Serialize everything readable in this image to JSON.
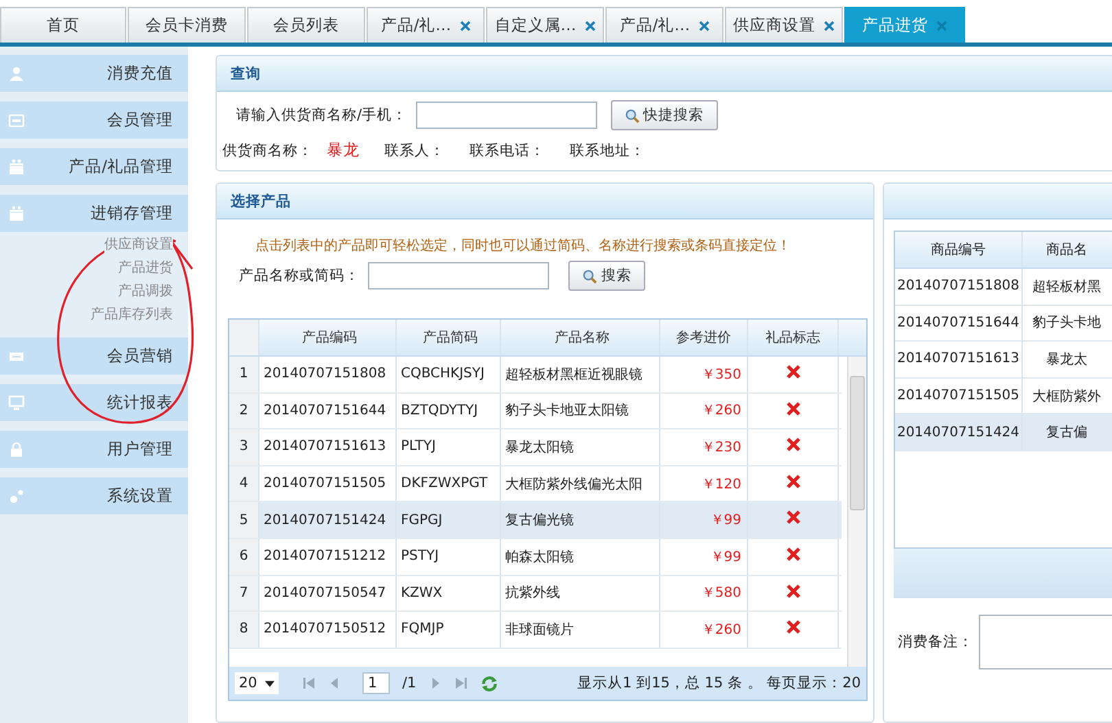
{
  "tabs": [
    {
      "label": "首页",
      "closable": false,
      "selected": false
    },
    {
      "label": "会员卡消费",
      "closable": false,
      "selected": false
    },
    {
      "label": "会员列表",
      "closable": false,
      "selected": false
    },
    {
      "label": "产品/礼…",
      "closable": true,
      "selected": false
    },
    {
      "label": "自定义属…",
      "closable": true,
      "selected": false
    },
    {
      "label": "产品/礼…",
      "closable": true,
      "selected": false
    },
    {
      "label": "供应商设置",
      "closable": true,
      "selected": false
    },
    {
      "label": "产品进货",
      "closable": true,
      "selected": true
    }
  ],
  "sidebar": {
    "items": [
      {
        "label": "消费充值"
      },
      {
        "label": "会员管理"
      },
      {
        "label": "产品/礼品管理"
      },
      {
        "label": "进销存管理",
        "children": [
          {
            "label": "供应商设置"
          },
          {
            "label": "产品进货"
          },
          {
            "label": "产品调拨"
          },
          {
            "label": "产品库存列表"
          }
        ]
      },
      {
        "label": "会员营销"
      },
      {
        "label": "统计报表"
      },
      {
        "label": "用户管理"
      },
      {
        "label": "系统设置"
      }
    ]
  },
  "query_panel": {
    "title": "查询",
    "search_label": "请输入供货商名称/手机：",
    "search_button": "快捷搜索",
    "info": [
      {
        "label": "供货商名称：",
        "value": "暴龙"
      },
      {
        "label": "联系人："
      },
      {
        "label": "联系电话："
      },
      {
        "label": "联系地址："
      }
    ]
  },
  "product_panel": {
    "title": "选择产品",
    "hint": "点击列表中的产品即可轻松选定，同时也可以通过简码、名称进行搜索或条码直接定位！",
    "search_label": "产品名称或简码：",
    "search_button": "搜索",
    "table": {
      "columns": [
        "产品编码",
        "产品简码",
        "产品名称",
        "参考进价",
        "礼品标志"
      ],
      "rows": [
        {
          "index": "1",
          "code": "20140707151808",
          "short": "CQBCHKJSYJ",
          "name": "超轻板材黑框近视眼镜",
          "price": "￥350",
          "gift": false,
          "selected": false
        },
        {
          "index": "2",
          "code": "20140707151644",
          "short": "BZTQDYTYJ",
          "name": "豹子头卡地亚太阳镜",
          "price": "￥260",
          "gift": false,
          "selected": false
        },
        {
          "index": "3",
          "code": "20140707151613",
          "short": "PLTYJ",
          "name": "暴龙太阳镜",
          "price": "￥230",
          "gift": false,
          "selected": false
        },
        {
          "index": "4",
          "code": "20140707151505",
          "short": "DKFZWXPGT",
          "name": "大框防紫外线偏光太阳",
          "price": "￥120",
          "gift": false,
          "selected": false
        },
        {
          "index": "5",
          "code": "20140707151424",
          "short": "FGPGJ",
          "name": "复古偏光镜",
          "price": "￥99",
          "gift": false,
          "selected": true
        },
        {
          "index": "6",
          "code": "20140707151212",
          "short": "PSTYJ",
          "name": "帕森太阳镜",
          "price": "￥99",
          "gift": false,
          "selected": false
        },
        {
          "index": "7",
          "code": "20140707150547",
          "short": "KZWX",
          "name": "抗紫外线",
          "price": "￥580",
          "gift": false,
          "selected": false
        },
        {
          "index": "8",
          "code": "20140707150512",
          "short": "FQMJP",
          "name": "非球面镜片",
          "price": "￥260",
          "gift": false,
          "selected": false
        }
      ]
    },
    "pager": {
      "page_size": "20",
      "page": "1",
      "total_pages": "/1",
      "summary": "显示从1 到15，总 15 条 。 每页显示：20"
    }
  },
  "cart_panel": {
    "columns": [
      "商品编号",
      "商品名"
    ],
    "rows": [
      {
        "code": "20140707151808",
        "name": "超轻板材黑",
        "selected": false
      },
      {
        "code": "20140707151644",
        "name": "豹子头卡地",
        "selected": false
      },
      {
        "code": "20140707151613",
        "name": "暴龙太",
        "selected": false
      },
      {
        "code": "20140707151505",
        "name": "大框防紫外",
        "selected": false
      },
      {
        "code": "20140707151424",
        "name": "复古偏",
        "selected": true
      }
    ],
    "note_label": "消费备注："
  }
}
